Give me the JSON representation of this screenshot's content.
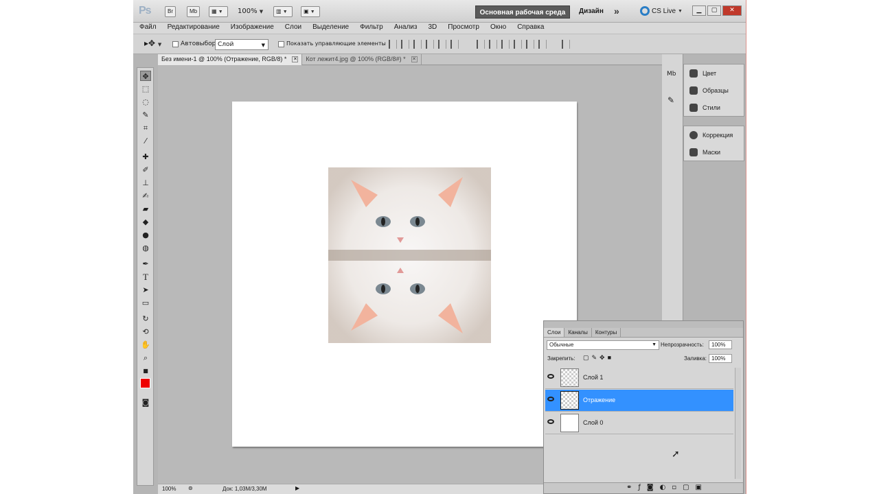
{
  "app": {
    "logo": "Ps",
    "bridge": "Br",
    "minibridge": "Mb",
    "zoom": "100%",
    "workspace": "Основная рабочая среда",
    "design": "Дизайн",
    "more": "»",
    "cs_live": "CS Live"
  },
  "menu": [
    "Файл",
    "Редактирование",
    "Изображение",
    "Слои",
    "Выделение",
    "Фильтр",
    "Анализ",
    "3D",
    "Просмотр",
    "Окно",
    "Справка"
  ],
  "options": {
    "autoselect_label": "Автовыбор:",
    "autoselect_value": "Слой",
    "show_controls_label": "Показать управляющие элементы"
  },
  "tabs": [
    {
      "label": "Без имени-1 @ 100% (Отражение, RGB/8) *",
      "active": true
    },
    {
      "label": "Кот лежит4.jpg @ 100% (RGB/8#) *",
      "active": false
    }
  ],
  "status": {
    "zoom": "100%",
    "doc": "Док: 1,03М/3,30М"
  },
  "dock": {
    "group1": [
      "Цвет",
      "Образцы",
      "Стили"
    ],
    "group2": [
      "Коррекция",
      "Маски"
    ]
  },
  "layers_panel": {
    "tabs": [
      "Слои",
      "Каналы",
      "Контуры"
    ],
    "blend_mode": "Обычные",
    "opacity_label": "Непрозрачность:",
    "opacity": "100%",
    "lock_label": "Закрепить:",
    "fill_label": "Заливка:",
    "fill": "100%",
    "layers": [
      {
        "name": "Слой 1",
        "selected": false
      },
      {
        "name": "Отражение",
        "selected": true
      },
      {
        "name": "Слой 0",
        "selected": false
      }
    ]
  },
  "colors": {
    "foreground": "#ee0000",
    "selection": "#3391ff",
    "workspace_button": "#5a5a5a"
  }
}
